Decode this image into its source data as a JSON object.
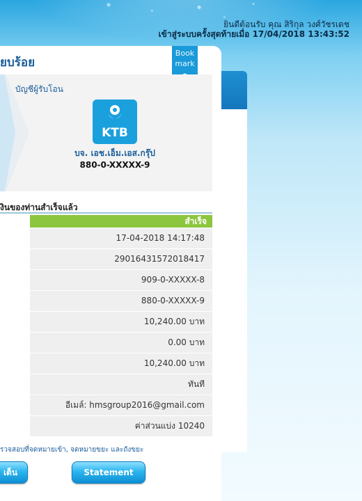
{
  "header": {
    "welcome_line1": "ยินดีต้อนรับ คุณ สิริกุล วงศ์วัชรเดช",
    "welcome_line2": "เข้าสู่ระบบครั้งสุดท้ายเมื่อ 17/04/2018 13:43:52"
  },
  "card": {
    "title": "ียบร้อย",
    "bookmark_line1": "Book",
    "bookmark_line2": "mark"
  },
  "recipient": {
    "label": "บัญชีผู้รับโอน",
    "bank_logo_text": "KTB",
    "bank_logo_icon": "garuda-bird-icon",
    "name": "บจ. เอช.เอ็ม.เอส.กรุ๊ป",
    "account": "880-0-XXXXX-9"
  },
  "details": {
    "section_title": "งินของท่านสำเร็จแล้ว",
    "status": "สำเร็จ",
    "rows": [
      "17-04-2018 14:17:48",
      "29016431572018417",
      "909-0-XXXXX-8",
      "880-0-XXXXX-9",
      "10,240.00 บาท",
      "0.00 บาท",
      "10,240.00 บาท",
      "ทันที",
      "อีเมล์: hmsgroup2016@gmail.com",
      "ค่าส่วนแบ่ง 10240"
    ]
  },
  "footer": {
    "note": "รวจสอบที่จดหมายเข้า, จดหมายขยะ และถังขยะ",
    "home_button": "เต็น",
    "statement_button": "Statement"
  },
  "colors": {
    "accent_blue": "#1a9ad8",
    "success_green": "#8cc63f",
    "title_blue": "#1a5e9a"
  }
}
